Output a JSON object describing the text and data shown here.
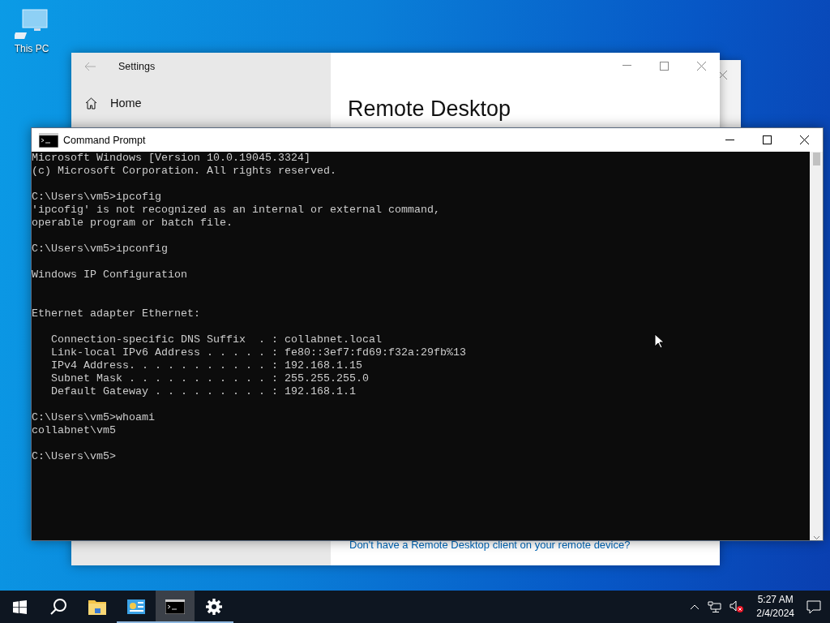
{
  "desktop": {
    "icons": [
      {
        "label": "This PC"
      }
    ]
  },
  "settings_window": {
    "title": "Settings",
    "nav": [
      {
        "label": "Home"
      }
    ],
    "heading": "Remote Desktop",
    "link": "Don't have a Remote Desktop client on your remote device?"
  },
  "console_window": {
    "title": "Command Prompt",
    "lines": [
      {
        "kind": "text",
        "text": "Microsoft Windows [Version 10.0.19045.3324]"
      },
      {
        "kind": "text",
        "text": "(c) Microsoft Corporation. All rights reserved."
      },
      {
        "kind": "blank"
      },
      {
        "kind": "text",
        "text": "C:\\Users\\vm5>ipcofig"
      },
      {
        "kind": "text",
        "text": "'ipcofig' is not recognized as an internal or external command,"
      },
      {
        "kind": "text",
        "text": "operable program or batch file."
      },
      {
        "kind": "blank"
      },
      {
        "kind": "text",
        "text": "C:\\Users\\vm5>ipconfig"
      },
      {
        "kind": "blank"
      },
      {
        "kind": "text",
        "text": "Windows IP Configuration"
      },
      {
        "kind": "blank"
      },
      {
        "kind": "blank"
      },
      {
        "kind": "text",
        "text": "Ethernet adapter Ethernet:"
      },
      {
        "kind": "blank"
      },
      {
        "kind": "text",
        "text": "   Connection-specific DNS Suffix  . : collabnet.local"
      },
      {
        "kind": "text",
        "text": "   Link-local IPv6 Address . . . . . : fe80::3ef7:fd69:f32a:29fb%13"
      },
      {
        "kind": "text",
        "text": "   IPv4 Address. . . . . . . . . . . : 192.168.1.15"
      },
      {
        "kind": "text",
        "text": "   Subnet Mask . . . . . . . . . . . : 255.255.255.0"
      },
      {
        "kind": "text",
        "text": "   Default Gateway . . . . . . . . . : 192.168.1.1"
      },
      {
        "kind": "blank"
      },
      {
        "kind": "text",
        "text": "C:\\Users\\vm5>whoami"
      },
      {
        "kind": "text",
        "text": "collabnet\\vm5"
      },
      {
        "kind": "blank"
      },
      {
        "kind": "text",
        "text": "C:\\Users\\vm5>"
      }
    ]
  },
  "taskbar": {
    "apps": [
      {
        "kind": "explorer",
        "open": false,
        "active": false
      },
      {
        "kind": "control_panel",
        "open": true,
        "active": false
      },
      {
        "kind": "console",
        "open": true,
        "active": true
      },
      {
        "kind": "settings",
        "open": true,
        "active": false
      }
    ],
    "tray": {
      "volume_muted": true,
      "time": "5:27 AM",
      "date": "2/4/2024"
    }
  }
}
